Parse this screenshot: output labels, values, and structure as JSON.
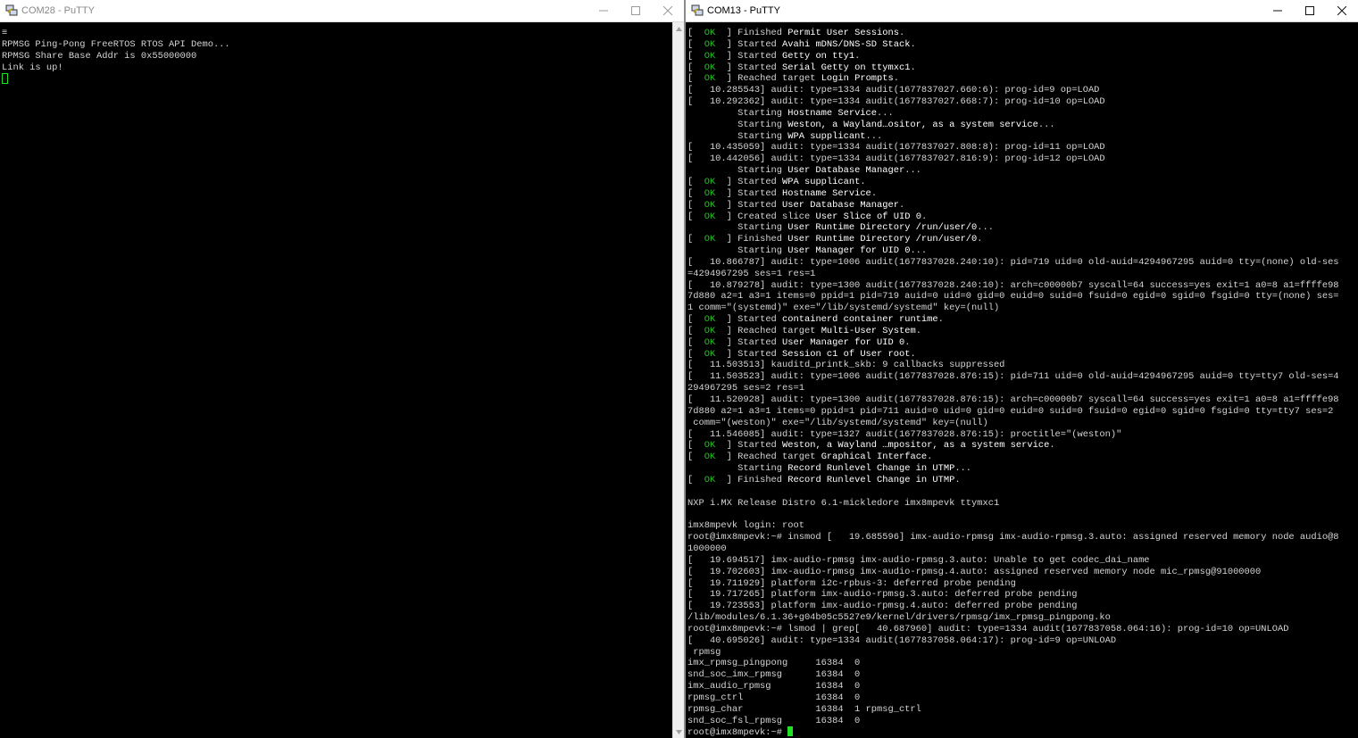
{
  "left_window": {
    "title": "COM28 - PuTTY",
    "lines": [
      [
        {
          "t": "≡"
        }
      ],
      [
        {
          "t": "RPMSG Ping-Pong FreeRTOS RTOS API Demo..."
        }
      ],
      [
        {
          "t": "RPMSG Share Base Addr is 0x55000000"
        }
      ],
      [
        {
          "t": "Link is up!"
        }
      ]
    ]
  },
  "right_window": {
    "title": "COM13 - PuTTY",
    "prompt": "root@imx8mpevk:~# ",
    "lines": [
      [
        {
          "t": "[  "
        },
        {
          "t": "OK",
          "c": "ok"
        },
        {
          "t": "  ] Finished "
        },
        {
          "t": "Permit User Sessions",
          "c": "hl"
        },
        {
          "t": "."
        }
      ],
      [
        {
          "t": "[  "
        },
        {
          "t": "OK",
          "c": "ok"
        },
        {
          "t": "  ] Started "
        },
        {
          "t": "Avahi mDNS/DNS-SD Stack",
          "c": "hl"
        },
        {
          "t": "."
        }
      ],
      [
        {
          "t": "[  "
        },
        {
          "t": "OK",
          "c": "ok"
        },
        {
          "t": "  ] Started "
        },
        {
          "t": "Getty on tty1",
          "c": "hl"
        },
        {
          "t": "."
        }
      ],
      [
        {
          "t": "[  "
        },
        {
          "t": "OK",
          "c": "ok"
        },
        {
          "t": "  ] Started "
        },
        {
          "t": "Serial Getty on ttymxc1",
          "c": "hl"
        },
        {
          "t": "."
        }
      ],
      [
        {
          "t": "[  "
        },
        {
          "t": "OK",
          "c": "ok"
        },
        {
          "t": "  ] Reached target "
        },
        {
          "t": "Login Prompts",
          "c": "hl"
        },
        {
          "t": "."
        }
      ],
      [
        {
          "t": "[   10.285543] audit: type=1334 audit(1677837027.660:6): prog-id=9 op=LOAD"
        }
      ],
      [
        {
          "t": "[   10.292362] audit: type=1334 audit(1677837027.668:7): prog-id=10 op=LOAD"
        }
      ],
      [
        {
          "t": "         Starting "
        },
        {
          "t": "Hostname Service",
          "c": "hl"
        },
        {
          "t": "..."
        }
      ],
      [
        {
          "t": "         Starting "
        },
        {
          "t": "Weston, a Wayland…ositor, as a system service",
          "c": "hl"
        },
        {
          "t": "..."
        }
      ],
      [
        {
          "t": "         Starting "
        },
        {
          "t": "WPA supplicant",
          "c": "hl"
        },
        {
          "t": "..."
        }
      ],
      [
        {
          "t": "[   10.435059] audit: type=1334 audit(1677837027.808:8): prog-id=11 op=LOAD"
        }
      ],
      [
        {
          "t": "[   10.442056] audit: type=1334 audit(1677837027.816:9): prog-id=12 op=LOAD"
        }
      ],
      [
        {
          "t": "         Starting "
        },
        {
          "t": "User Database Manager",
          "c": "hl"
        },
        {
          "t": "..."
        }
      ],
      [
        {
          "t": "[  "
        },
        {
          "t": "OK",
          "c": "ok"
        },
        {
          "t": "  ] Started "
        },
        {
          "t": "WPA supplicant",
          "c": "hl"
        },
        {
          "t": "."
        }
      ],
      [
        {
          "t": "[  "
        },
        {
          "t": "OK",
          "c": "ok"
        },
        {
          "t": "  ] Started "
        },
        {
          "t": "Hostname Service",
          "c": "hl"
        },
        {
          "t": "."
        }
      ],
      [
        {
          "t": "[  "
        },
        {
          "t": "OK",
          "c": "ok"
        },
        {
          "t": "  ] Started "
        },
        {
          "t": "User Database Manager",
          "c": "hl"
        },
        {
          "t": "."
        }
      ],
      [
        {
          "t": "[  "
        },
        {
          "t": "OK",
          "c": "ok"
        },
        {
          "t": "  ] Created slice "
        },
        {
          "t": "User Slice of UID 0",
          "c": "hl"
        },
        {
          "t": "."
        }
      ],
      [
        {
          "t": "         Starting "
        },
        {
          "t": "User Runtime Directory /run/user/0",
          "c": "hl"
        },
        {
          "t": "..."
        }
      ],
      [
        {
          "t": "[  "
        },
        {
          "t": "OK",
          "c": "ok"
        },
        {
          "t": "  ] Finished "
        },
        {
          "t": "User Runtime Directory /run/user/0",
          "c": "hl"
        },
        {
          "t": "."
        }
      ],
      [
        {
          "t": "         Starting "
        },
        {
          "t": "User Manager for UID 0",
          "c": "hl"
        },
        {
          "t": "..."
        }
      ],
      [
        {
          "t": "[   10.866787] audit: type=1006 audit(1677837028.240:10): pid=719 uid=0 old-auid=4294967295 auid=0 tty=(none) old-ses"
        }
      ],
      [
        {
          "t": "=4294967295 ses=1 res=1"
        }
      ],
      [
        {
          "t": "[   10.879278] audit: type=1300 audit(1677837028.240:10): arch=c00000b7 syscall=64 success=yes exit=1 a0=8 a1=ffffe98"
        }
      ],
      [
        {
          "t": "7d880 a2=1 a3=1 items=0 ppid=1 pid=719 auid=0 uid=0 gid=0 euid=0 suid=0 fsuid=0 egid=0 sgid=0 fsgid=0 tty=(none) ses="
        }
      ],
      [
        {
          "t": "1 comm=\"(systemd)\" exe=\"/lib/systemd/systemd\" key=(null)"
        }
      ],
      [
        {
          "t": "[  "
        },
        {
          "t": "OK",
          "c": "ok"
        },
        {
          "t": "  ] Started "
        },
        {
          "t": "containerd container runtime",
          "c": "hl"
        },
        {
          "t": "."
        }
      ],
      [
        {
          "t": "[  "
        },
        {
          "t": "OK",
          "c": "ok"
        },
        {
          "t": "  ] Reached target "
        },
        {
          "t": "Multi-User System",
          "c": "hl"
        },
        {
          "t": "."
        }
      ],
      [
        {
          "t": "[  "
        },
        {
          "t": "OK",
          "c": "ok"
        },
        {
          "t": "  ] Started "
        },
        {
          "t": "User Manager for UID 0",
          "c": "hl"
        },
        {
          "t": "."
        }
      ],
      [
        {
          "t": "[  "
        },
        {
          "t": "OK",
          "c": "ok"
        },
        {
          "t": "  ] Started "
        },
        {
          "t": "Session c1 of User root",
          "c": "hl"
        },
        {
          "t": "."
        }
      ],
      [
        {
          "t": "[   11.503513] kauditd_printk_skb: 9 callbacks suppressed"
        }
      ],
      [
        {
          "t": "[   11.503523] audit: type=1006 audit(1677837028.876:15): pid=711 uid=0 old-auid=4294967295 auid=0 tty=tty7 old-ses=4"
        }
      ],
      [
        {
          "t": "294967295 ses=2 res=1"
        }
      ],
      [
        {
          "t": "[   11.520928] audit: type=1300 audit(1677837028.876:15): arch=c00000b7 syscall=64 success=yes exit=1 a0=8 a1=ffffe98"
        }
      ],
      [
        {
          "t": "7d880 a2=1 a3=1 items=0 ppid=1 pid=711 auid=0 uid=0 gid=0 euid=0 suid=0 fsuid=0 egid=0 sgid=0 fsgid=0 tty=tty7 ses=2"
        }
      ],
      [
        {
          "t": " comm=\"(weston)\" exe=\"/lib/systemd/systemd\" key=(null)"
        }
      ],
      [
        {
          "t": "[   11.546085] audit: type=1327 audit(1677837028.876:15): proctitle=\"(weston)\""
        }
      ],
      [
        {
          "t": "[  "
        },
        {
          "t": "OK",
          "c": "ok"
        },
        {
          "t": "  ] Started "
        },
        {
          "t": "Weston, a Wayland …mpositor, as a system service",
          "c": "hl"
        },
        {
          "t": "."
        }
      ],
      [
        {
          "t": "[  "
        },
        {
          "t": "OK",
          "c": "ok"
        },
        {
          "t": "  ] Reached target "
        },
        {
          "t": "Graphical Interface",
          "c": "hl"
        },
        {
          "t": "."
        }
      ],
      [
        {
          "t": "         Starting "
        },
        {
          "t": "Record Runlevel Change in UTMP",
          "c": "hl"
        },
        {
          "t": "..."
        }
      ],
      [
        {
          "t": "[  "
        },
        {
          "t": "OK",
          "c": "ok"
        },
        {
          "t": "  ] Finished "
        },
        {
          "t": "Record Runlevel Change in UTMP",
          "c": "hl"
        },
        {
          "t": "."
        }
      ],
      [
        {
          "t": ""
        }
      ],
      [
        {
          "t": "NXP i.MX Release Distro 6.1-mickledore imx8mpevk ttymxc1"
        }
      ],
      [
        {
          "t": ""
        }
      ],
      [
        {
          "t": "imx8mpevk login: root"
        }
      ],
      [
        {
          "t": "root@imx8mpevk:~# insmod [   19.685596] imx-audio-rpmsg imx-audio-rpmsg.3.auto: assigned reserved memory node audio@8"
        }
      ],
      [
        {
          "t": "1000000"
        }
      ],
      [
        {
          "t": "[   19.694517] imx-audio-rpmsg imx-audio-rpmsg.3.auto: Unable to get codec_dai_name"
        }
      ],
      [
        {
          "t": "[   19.702603] imx-audio-rpmsg imx-audio-rpmsg.4.auto: assigned reserved memory node mic_rpmsg@91000000"
        }
      ],
      [
        {
          "t": "[   19.711929] platform i2c-rpbus-3: deferred probe pending"
        }
      ],
      [
        {
          "t": "[   19.717265] platform imx-audio-rpmsg.3.auto: deferred probe pending"
        }
      ],
      [
        {
          "t": "[   19.723553] platform imx-audio-rpmsg.4.auto: deferred probe pending"
        }
      ],
      [
        {
          "t": "/lib/modules/6.1.36+g04b05c5527e9/kernel/drivers/rpmsg/imx_rpmsg_pingpong.ko"
        }
      ],
      [
        {
          "t": "root@imx8mpevk:~# lsmod | grep[   40.687960] audit: type=1334 audit(1677837058.064:16): prog-id=10 op=UNLOAD"
        }
      ],
      [
        {
          "t": "[   40.695026] audit: type=1334 audit(1677837058.064:17): prog-id=9 op=UNLOAD"
        }
      ],
      [
        {
          "t": " rpmsg"
        }
      ],
      [
        {
          "t": "imx_rpmsg_pingpong     16384  0"
        }
      ],
      [
        {
          "t": "snd_soc_imx_rpmsg      16384  0"
        }
      ],
      [
        {
          "t": "imx_audio_rpmsg        16384  0"
        }
      ],
      [
        {
          "t": "rpmsg_ctrl             16384  0"
        }
      ],
      [
        {
          "t": "rpmsg_char             16384  1 rpmsg_ctrl"
        }
      ],
      [
        {
          "t": "snd_soc_fsl_rpmsg      16384  0"
        }
      ]
    ]
  },
  "icons": {
    "app": "putty-icon",
    "minimize": "minimize-icon",
    "maximize": "maximize-icon",
    "close": "close-icon",
    "scroll_up": "scroll-up-icon",
    "scroll_down": "scroll-down-icon"
  },
  "colors": {
    "terminal_bg": "#000000",
    "terminal_text": "#d4d4d4",
    "ok_green": "#22c322",
    "cursor_green": "#22e022",
    "highlight": "#ffffff"
  }
}
